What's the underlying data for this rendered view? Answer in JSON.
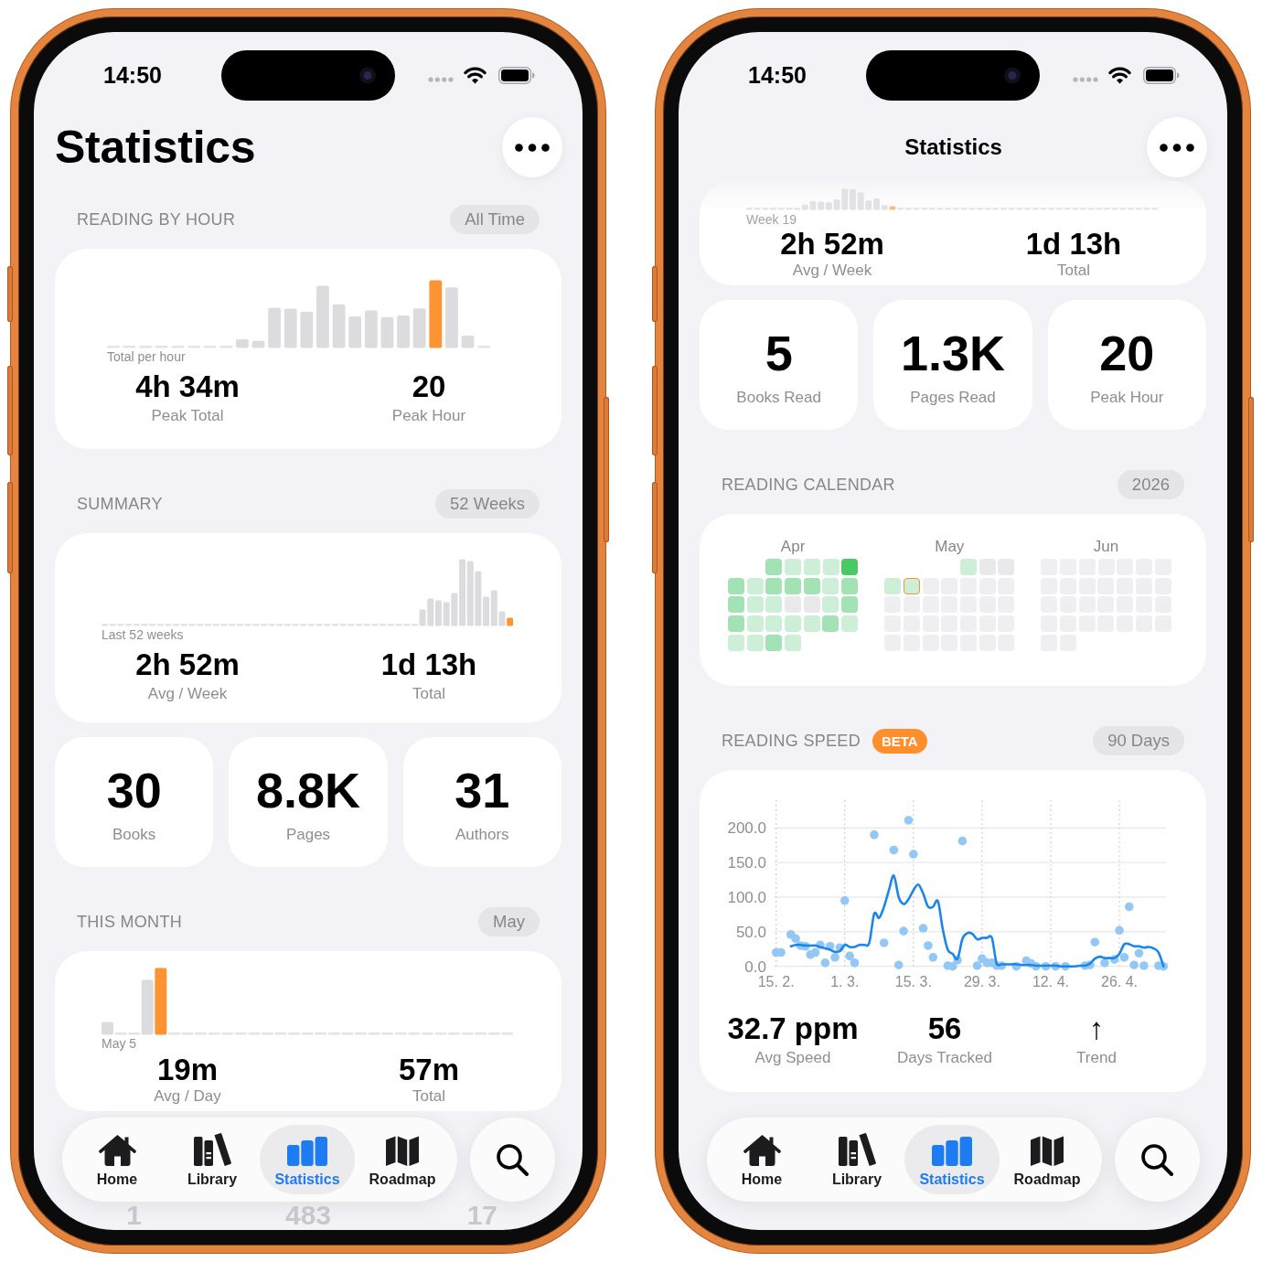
{
  "phones": [
    {
      "status_bar": {
        "time": "14:50"
      },
      "nav": {
        "kind": "large",
        "title": "Statistics"
      },
      "sections": [
        {
          "kind": "header",
          "title": "READING BY HOUR",
          "pill": "All Time"
        },
        {
          "kind": "hour_chart_card",
          "caption": "Total per hour",
          "metrics": [
            {
              "value": "4h 34m",
              "label": "Peak Total"
            },
            {
              "value": "20",
              "label": "Peak Hour"
            }
          ]
        },
        {
          "kind": "header",
          "title": "SUMMARY",
          "pill": "52 Weeks"
        },
        {
          "kind": "week_chart_card",
          "caption": "Last 52 weeks",
          "metrics": [
            {
              "value": "2h 52m",
              "label": "Avg / Week"
            },
            {
              "value": "1d 13h",
              "label": "Total"
            }
          ]
        },
        {
          "kind": "tiles",
          "tiles": [
            {
              "value": "30",
              "label": "Books"
            },
            {
              "value": "8.8K",
              "label": "Pages"
            },
            {
              "value": "31",
              "label": "Authors"
            }
          ]
        },
        {
          "kind": "header",
          "title": "THIS MONTH",
          "pill": "May"
        },
        {
          "kind": "day_chart_card",
          "caption": "May 5",
          "metrics": [
            {
              "value": "19m",
              "label": "Avg / Day"
            },
            {
              "value": "57m",
              "label": "Total"
            }
          ]
        },
        {
          "kind": "peek_row",
          "values": [
            "1",
            "483",
            "17"
          ]
        }
      ],
      "tab_bar": {
        "tabs": [
          {
            "label": "Home",
            "selected": false
          },
          {
            "label": "Library",
            "selected": false
          },
          {
            "label": "Statistics",
            "selected": true
          },
          {
            "label": "Roadmap",
            "selected": false
          }
        ]
      }
    },
    {
      "status_bar": {
        "time": "14:50"
      },
      "nav": {
        "kind": "compact",
        "title": "Statistics"
      },
      "sections": [
        {
          "kind": "faded_week_chart_card",
          "caption": "Week 19",
          "metrics": [
            {
              "value": "2h 52m",
              "label": "Avg / Week"
            },
            {
              "value": "1d 13h",
              "label": "Total"
            }
          ]
        },
        {
          "kind": "tiles",
          "tiles": [
            {
              "value": "5",
              "label": "Books Read"
            },
            {
              "value": "1.3K",
              "label": "Pages Read"
            },
            {
              "value": "20",
              "label": "Peak Hour"
            }
          ]
        },
        {
          "kind": "header",
          "title": "READING CALENDAR",
          "pill": "2026"
        },
        {
          "kind": "calendar_card",
          "months": [
            {
              "label": "Apr",
              "weeks": [
                [
                  {
                    "color": "#a3e2b4",
                    "today": false
                  },
                  {
                    "color": "#cdeed7",
                    "today": false
                  },
                  {
                    "color": "#cdeed7",
                    "today": false
                  },
                  {
                    "color": "#cdeed7",
                    "today": false
                  },
                  {
                    "color": "#4bc963",
                    "today": false
                  }
                ],
                [
                  {
                    "color": "#a3e2b4",
                    "today": false
                  },
                  {
                    "color": "#cdeed7",
                    "today": false
                  },
                  {
                    "color": "#a3e2b4",
                    "today": false
                  },
                  {
                    "color": "#a3e2b4",
                    "today": false
                  },
                  {
                    "color": "#a3e2b4",
                    "today": false
                  },
                  {
                    "color": "#cdeed7",
                    "today": false
                  },
                  {
                    "color": "#a3e2b4",
                    "today": false
                  }
                ],
                [
                  {
                    "color": "#a3e2b4",
                    "today": false
                  },
                  {
                    "color": "#cdeed7",
                    "today": false
                  },
                  {
                    "color": "#cdeed7",
                    "today": false
                  },
                  {
                    "color": "#e9e9eb",
                    "today": false
                  },
                  {
                    "color": "#e9e9eb",
                    "today": false
                  },
                  {
                    "color": "#cdeed7",
                    "today": false
                  },
                  {
                    "color": "#a3e2b4",
                    "today": false
                  }
                ],
                [
                  {
                    "color": "#a3e2b4",
                    "today": false
                  },
                  {
                    "color": "#cdeed7",
                    "today": false
                  },
                  {
                    "color": "#cdeed7",
                    "today": false
                  },
                  {
                    "color": "#cdeed7",
                    "today": false
                  },
                  {
                    "color": "#cdeed7",
                    "today": false
                  },
                  {
                    "color": "#a3e2b4",
                    "today": false
                  },
                  {
                    "color": "#cdeed7",
                    "today": false
                  }
                ],
                [
                  {
                    "color": "#cdeed7",
                    "today": false
                  },
                  {
                    "color": "#cdeed7",
                    "today": false
                  },
                  {
                    "color": "#a3e2b4",
                    "today": false
                  },
                  {
                    "color": "#cdeed7",
                    "today": false
                  }
                ]
              ]
            },
            {
              "label": "May",
              "weeks": [
                [
                  {
                    "color": "#cdeed7",
                    "today": false
                  },
                  {
                    "color": "#e9e9eb",
                    "today": false
                  },
                  {
                    "color": "#e9e9eb",
                    "today": false
                  }
                ],
                [
                  {
                    "color": "#cdeed7",
                    "today": false
                  },
                  {
                    "color": "#cdeed7",
                    "today": true
                  },
                  {
                    "color": "#efeff1",
                    "today": false
                  },
                  {
                    "color": "#efeff1",
                    "today": false
                  },
                  {
                    "color": "#efeff1",
                    "today": false
                  },
                  {
                    "color": "#efeff1",
                    "today": false
                  },
                  {
                    "color": "#efeff1",
                    "today": false
                  }
                ],
                [
                  {
                    "color": "#efeff1",
                    "today": false
                  },
                  {
                    "color": "#efeff1",
                    "today": false
                  },
                  {
                    "color": "#efeff1",
                    "today": false
                  },
                  {
                    "color": "#efeff1",
                    "today": false
                  },
                  {
                    "color": "#efeff1",
                    "today": false
                  },
                  {
                    "color": "#efeff1",
                    "today": false
                  },
                  {
                    "color": "#efeff1",
                    "today": false
                  }
                ],
                [
                  {
                    "color": "#efeff1",
                    "today": false
                  },
                  {
                    "color": "#efeff1",
                    "today": false
                  },
                  {
                    "color": "#efeff1",
                    "today": false
                  },
                  {
                    "color": "#efeff1",
                    "today": false
                  },
                  {
                    "color": "#efeff1",
                    "today": false
                  },
                  {
                    "color": "#efeff1",
                    "today": false
                  },
                  {
                    "color": "#efeff1",
                    "today": false
                  }
                ],
                [
                  {
                    "color": "#efeff1",
                    "today": false
                  },
                  {
                    "color": "#efeff1",
                    "today": false
                  },
                  {
                    "color": "#efeff1",
                    "today": false
                  },
                  {
                    "color": "#efeff1",
                    "today": false
                  },
                  {
                    "color": "#efeff1",
                    "today": false
                  },
                  {
                    "color": "#efeff1",
                    "today": false
                  },
                  {
                    "color": "#efeff1",
                    "today": false
                  }
                ]
              ]
            },
            {
              "label": "Jun",
              "weeks": [
                [
                  {
                    "color": "#efeff1",
                    "today": false
                  },
                  {
                    "color": "#efeff1",
                    "today": false
                  },
                  {
                    "color": "#efeff1",
                    "today": false
                  },
                  {
                    "color": "#efeff1",
                    "today": false
                  },
                  {
                    "color": "#efeff1",
                    "today": false
                  },
                  {
                    "color": "#efeff1",
                    "today": false
                  },
                  {
                    "color": "#efeff1",
                    "today": false
                  }
                ],
                [
                  {
                    "color": "#efeff1",
                    "today": false
                  },
                  {
                    "color": "#efeff1",
                    "today": false
                  },
                  {
                    "color": "#efeff1",
                    "today": false
                  },
                  {
                    "color": "#efeff1",
                    "today": false
                  },
                  {
                    "color": "#efeff1",
                    "today": false
                  },
                  {
                    "color": "#efeff1",
                    "today": false
                  },
                  {
                    "color": "#efeff1",
                    "today": false
                  }
                ],
                [
                  {
                    "color": "#efeff1",
                    "today": false
                  },
                  {
                    "color": "#efeff1",
                    "today": false
                  },
                  {
                    "color": "#efeff1",
                    "today": false
                  },
                  {
                    "color": "#efeff1",
                    "today": false
                  },
                  {
                    "color": "#efeff1",
                    "today": false
                  },
                  {
                    "color": "#efeff1",
                    "today": false
                  },
                  {
                    "color": "#efeff1",
                    "today": false
                  }
                ],
                [
                  {
                    "color": "#efeff1",
                    "today": false
                  },
                  {
                    "color": "#efeff1",
                    "today": false
                  },
                  {
                    "color": "#efeff1",
                    "today": false
                  },
                  {
                    "color": "#efeff1",
                    "today": false
                  },
                  {
                    "color": "#efeff1",
                    "today": false
                  },
                  {
                    "color": "#efeff1",
                    "today": false
                  },
                  {
                    "color": "#efeff1",
                    "today": false
                  }
                ],
                [
                  {
                    "color": "#efeff1",
                    "today": false
                  },
                  {
                    "color": "#efeff1",
                    "today": false
                  }
                ]
              ]
            }
          ]
        },
        {
          "kind": "header",
          "title": "READING SPEED",
          "badge": "BETA",
          "pill": "90 Days"
        },
        {
          "kind": "speed_card",
          "chart_data": {
            "type": "scatter",
            "grid": true,
            "categories": [
              "15. 2.",
              null,
              null,
              null,
              null,
              null,
              null,
              null,
              null,
              null,
              null,
              null,
              null,
              null,
              "1. 3.",
              null,
              null,
              null,
              null,
              null,
              null,
              null,
              null,
              null,
              null,
              null,
              null,
              null,
              "15. 3.",
              null,
              null,
              null,
              null,
              null,
              null,
              null,
              null,
              null,
              null,
              null,
              null,
              null,
              "29. 3.",
              null,
              null,
              null,
              null,
              null,
              null,
              null,
              null,
              null,
              null,
              null,
              null,
              null,
              "12. 4.",
              null,
              null,
              null,
              null,
              null,
              null,
              null,
              null,
              null,
              null,
              null,
              null,
              null,
              "26. 4.",
              null,
              null,
              null,
              null,
              null,
              null,
              null,
              null,
              null
            ],
            "ylim": [
              0,
              240
            ],
            "yticks": [
              {
                "value": 0,
                "label": "0.0"
              },
              {
                "value": 50,
                "label": "50.0"
              },
              {
                "value": 100,
                "label": "100.0"
              },
              {
                "value": 150,
                "label": "150.0"
              },
              {
                "value": 200,
                "label": "200.0"
              }
            ],
            "series": [
              {
                "color": "#93c8f6",
                "values": [
                  20,
                  20,
                  null,
                  46,
                  40,
                  30,
                  29,
                  17,
                  20,
                  31,
                  5,
                  29,
                  13,
                  27,
                  95,
                  15,
                  5,
                  null,
                  null,
                  null,
                  190,
                  null,
                  34,
                  null,
                  168,
                  2,
                  51,
                  211,
                  162,
                  null,
                  55,
                  30,
                  13,
                  null,
                  null,
                  1,
                  0,
                  9,
                  181,
                  null,
                  null,
                  1,
                  11,
                  5,
                  5,
                  1,
                  1,
                  null,
                  null,
                  0,
                  null,
                  8,
                  4,
                  0,
                  null,
                  0,
                  null,
                  0,
                  null,
                  0,
                  null,
                  null,
                  null,
                  1,
                  2,
                  35,
                  null,
                  5,
                  null,
                  10,
                  52,
                  13,
                  86,
                  2,
                  19,
                  1,
                  null,
                  null,
                  1,
                  0
                ]
              },
              {
                "type": "line",
                "color": "#1b86ea",
                "values": [
                  null,
                  null,
                  null,
                  29,
                  31,
                  31,
                  30,
                  30,
                  30,
                  28,
                  26,
                  24,
                  21,
                  22,
                  31,
                  28,
                  28,
                  31,
                  31,
                  34,
                  76,
                  70,
                  86,
                  110,
                  131,
                  100,
                  90,
                  97,
                  110,
                  118,
                  105,
                  86,
                  86,
                  94,
                  53,
                  24,
                  18,
                  11,
                  40,
                  48,
                  47,
                  39,
                  41,
                  41,
                  41,
                  3,
                  3,
                  3,
                  3,
                  3,
                  2,
                  2,
                  2,
                  1,
                  1,
                  1,
                  1,
                  1,
                  0,
                  0,
                  0,
                  0,
                  1,
                  1,
                  4,
                  11,
                  14,
                  12,
                  12,
                  12,
                  18,
                  32,
                  32,
                  29,
                  29,
                  27,
                  28,
                  26,
                  20,
                  0
                ]
              }
            ]
          },
          "metrics": [
            {
              "value": "32.7 ppm",
              "label": "Avg Speed"
            },
            {
              "value": "56",
              "label": "Days Tracked"
            },
            {
              "value": "↑",
              "label": "Trend"
            }
          ]
        }
      ],
      "tab_bar": {
        "tabs": [
          {
            "label": "Home",
            "selected": false
          },
          {
            "label": "Library",
            "selected": false
          },
          {
            "label": "Statistics",
            "selected": true
          },
          {
            "label": "Roadmap",
            "selected": false
          }
        ]
      }
    }
  ]
}
